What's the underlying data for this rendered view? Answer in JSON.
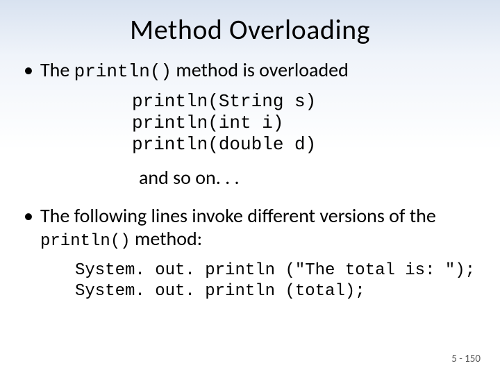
{
  "title": "Method Overloading",
  "bullet1": {
    "pre": "The ",
    "code": "println()",
    "post": " method is overloaded"
  },
  "code1": "println(String s)\nprintln(int i)\nprintln(double d)",
  "andso": "and so on. . .",
  "bullet2": {
    "pre": "The following lines invoke different versions of the ",
    "code": "println()",
    "post": " method:"
  },
  "code2": "System. out. println (\"The total is: \");\nSystem. out. println (total);",
  "footer": "5 - 150"
}
